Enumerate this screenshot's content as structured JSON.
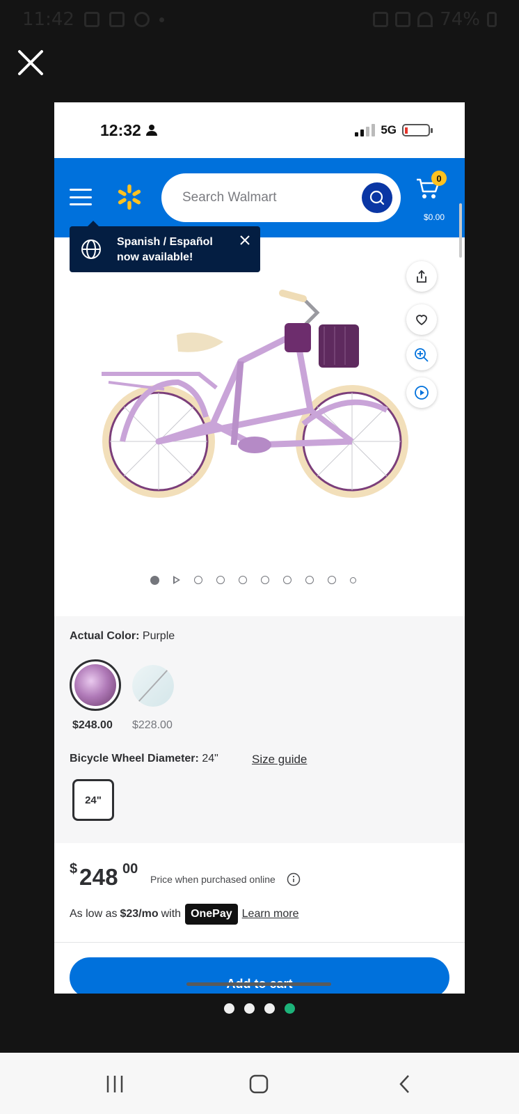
{
  "outer_status": {
    "time": "11:42",
    "battery": "74%"
  },
  "inner_status": {
    "time": "12:32",
    "network": "5G"
  },
  "header": {
    "search_placeholder": "Search Walmart",
    "cart_count": "0",
    "cart_total": "$0.00",
    "accent_color": "#0071dc",
    "spark_color": "#ffc220"
  },
  "language_tip": {
    "line1": "Spanish / Español",
    "line2": "now available!"
  },
  "image_actions": [
    "share-icon",
    "heart-icon",
    "zoom-icon",
    "play-icon"
  ],
  "gallery": {
    "total_slides": 10,
    "active_index": 0
  },
  "color": {
    "label": "Actual Color:",
    "value": "Purple",
    "options": [
      {
        "price": "$248.00",
        "selected": true
      },
      {
        "price": "$228.00",
        "selected": false
      }
    ]
  },
  "wheel": {
    "label": "Bicycle Wheel Diameter:",
    "value": "24\"",
    "size_guide": "Size guide",
    "chip": "24\""
  },
  "price": {
    "dollar_sign": "$",
    "main": "248",
    "cents": "00",
    "note": "Price when purchased online"
  },
  "affordability": {
    "prefix": "As low as",
    "amount": "$23/mo",
    "with": "with",
    "brand": "OnePay",
    "learn_more": "Learn more"
  },
  "cta": {
    "add_to_cart": "Add to cart"
  },
  "pager": {
    "count": 4,
    "active_index": 3
  }
}
